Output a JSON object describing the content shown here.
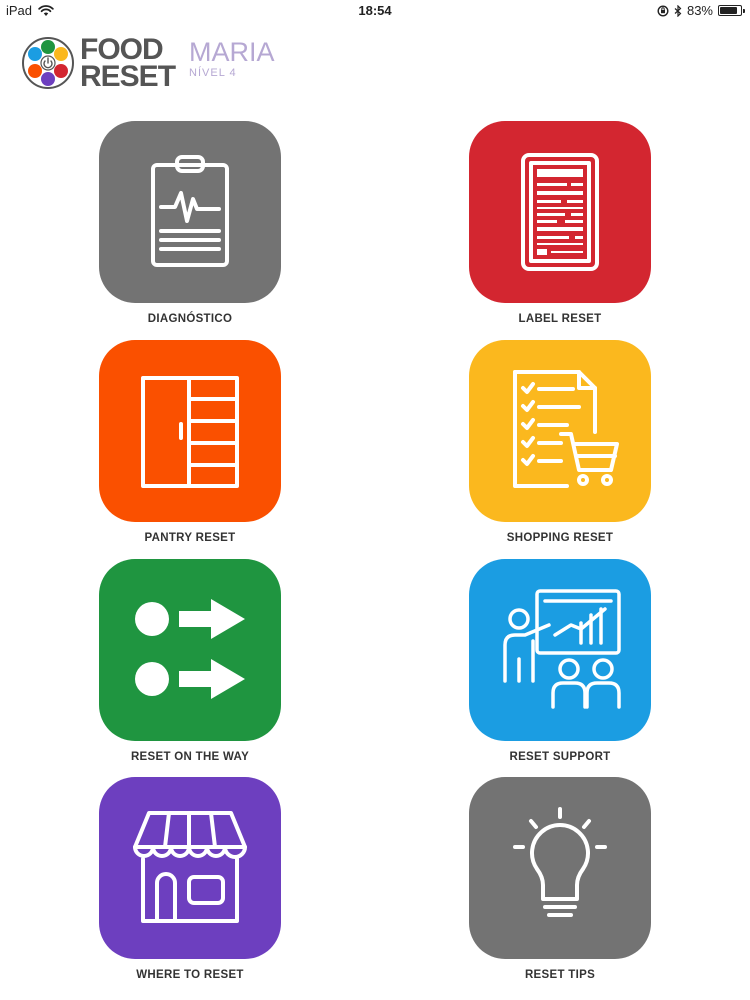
{
  "status_bar": {
    "device": "iPad",
    "time": "18:54",
    "battery": "83%",
    "battery_level": 0.83
  },
  "header": {
    "brand_line1": "FOOD",
    "brand_line2": "RESET",
    "user_name": "MARIA",
    "user_level": "NÍVEL 4"
  },
  "tiles": [
    {
      "label": "DIAGNÓSTICO",
      "color": "#737373",
      "icon": "clipboard-heartbeat-icon"
    },
    {
      "label": "LABEL RESET",
      "color": "#d32630",
      "icon": "nutrition-label-icon"
    },
    {
      "label": "PANTRY RESET",
      "color": "#fa5000",
      "icon": "pantry-cabinet-icon"
    },
    {
      "label": "SHOPPING RESET",
      "color": "#fbb81e",
      "icon": "shopping-list-cart-icon"
    },
    {
      "label": "RESET ON THE WAY",
      "color": "#1f9540",
      "icon": "dots-arrows-icon"
    },
    {
      "label": "RESET SUPPORT",
      "color": "#1b9de2",
      "icon": "presentation-audience-icon"
    },
    {
      "label": "WHERE TO RESET",
      "color": "#6d3fbf",
      "icon": "storefront-icon"
    },
    {
      "label": "RESET TIPS",
      "color": "#737373",
      "icon": "lightbulb-icon"
    }
  ]
}
